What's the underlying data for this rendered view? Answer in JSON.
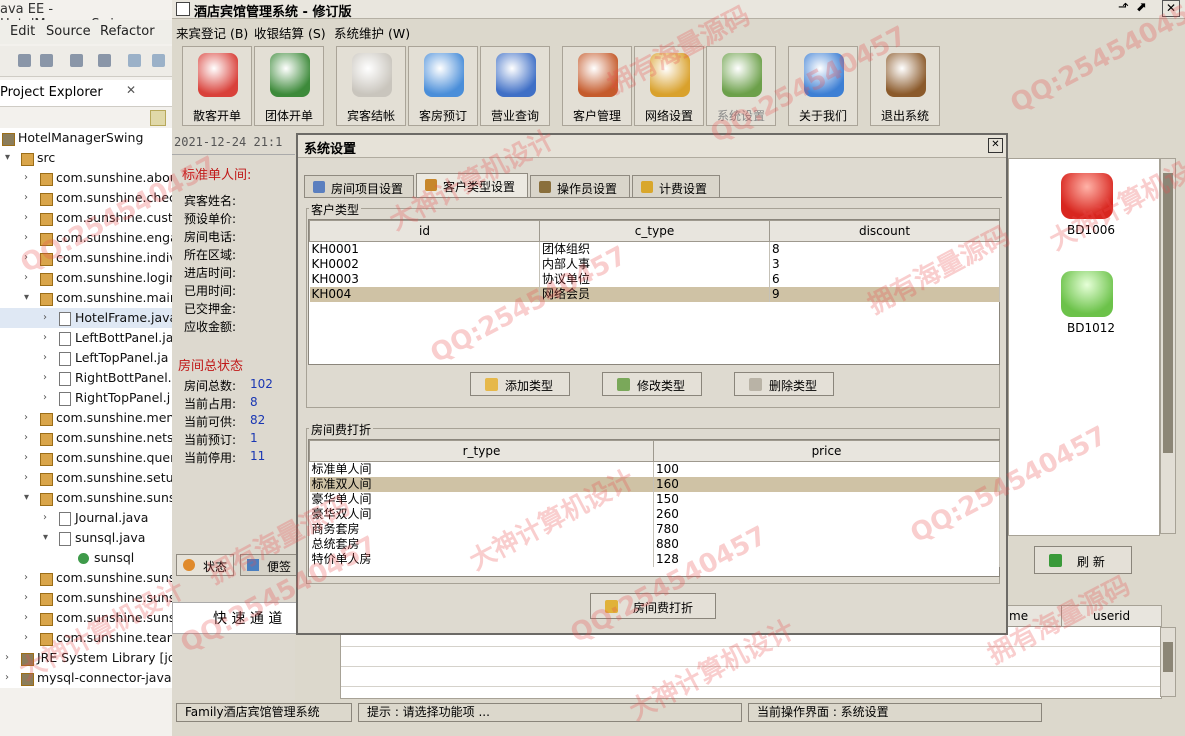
{
  "eclipse": {
    "title": "ava EE - HotelManagerSwing",
    "menus": [
      "Edit",
      "Source",
      "Refactor"
    ],
    "view_title": "Project Explorer",
    "tree": [
      {
        "label": "HotelManagerSwing",
        "depth": 0,
        "kind": "project",
        "expanded": true
      },
      {
        "label": "src",
        "depth": 1,
        "kind": "folder",
        "expanded": true
      },
      {
        "label": "com.sunshine.abou",
        "depth": 2,
        "kind": "package"
      },
      {
        "label": "com.sunshine.chec",
        "depth": 2,
        "kind": "package"
      },
      {
        "label": "com.sunshine.custo",
        "depth": 2,
        "kind": "package"
      },
      {
        "label": "com.sunshine.enga",
        "depth": 2,
        "kind": "package"
      },
      {
        "label": "com.sunshine.indiv",
        "depth": 2,
        "kind": "package"
      },
      {
        "label": "com.sunshine.login",
        "depth": 2,
        "kind": "package"
      },
      {
        "label": "com.sunshine.main",
        "depth": 2,
        "kind": "package",
        "expanded": true
      },
      {
        "label": "HotelFrame.java",
        "depth": 3,
        "kind": "file",
        "selected": true
      },
      {
        "label": "LeftBottPanel.ja",
        "depth": 3,
        "kind": "file"
      },
      {
        "label": "LeftTopPanel.ja",
        "depth": 3,
        "kind": "file"
      },
      {
        "label": "RightBottPanel.",
        "depth": 3,
        "kind": "file"
      },
      {
        "label": "RightTopPanel.j",
        "depth": 3,
        "kind": "file"
      },
      {
        "label": "com.sunshine.menu",
        "depth": 2,
        "kind": "package"
      },
      {
        "label": "com.sunshine.netse",
        "depth": 2,
        "kind": "package"
      },
      {
        "label": "com.sunshine.quer",
        "depth": 2,
        "kind": "package"
      },
      {
        "label": "com.sunshine.setup",
        "depth": 2,
        "kind": "package"
      },
      {
        "label": "com.sunshine.suns",
        "depth": 2,
        "kind": "package",
        "expanded": true
      },
      {
        "label": "Journal.java",
        "depth": 3,
        "kind": "file"
      },
      {
        "label": "sunsql.java",
        "depth": 3,
        "kind": "file",
        "expanded": true
      },
      {
        "label": "sunsql",
        "depth": 4,
        "kind": "class"
      },
      {
        "label": "com.sunshine.suns",
        "depth": 2,
        "kind": "package"
      },
      {
        "label": "com.sunshine.suns",
        "depth": 2,
        "kind": "package"
      },
      {
        "label": "com.sunshine.suns",
        "depth": 2,
        "kind": "package"
      },
      {
        "label": "com.sunshine.team",
        "depth": 2,
        "kind": "package"
      },
      {
        "label": "JRE System Library [jd",
        "depth": 1,
        "kind": "library"
      },
      {
        "label": "mysql-connector-java",
        "depth": 1,
        "kind": "library"
      }
    ]
  },
  "app": {
    "title": "酒店宾馆管理系统 - 修订版",
    "menus": [
      "来宾登记 (B)",
      "收银结算 (S)",
      "系统维护 (W)"
    ],
    "toolbar": [
      {
        "label": "散客开单",
        "icon": "person-icon",
        "color": "#d9413a"
      },
      {
        "label": "团体开单",
        "icon": "group-icon",
        "color": "#3d8a3a"
      },
      {
        "label": "宾客结帐",
        "icon": "monitor-icon",
        "color": "#c9c5bd"
      },
      {
        "label": "客房预订",
        "icon": "compass-icon",
        "color": "#4a8ed9"
      },
      {
        "label": "营业查询",
        "icon": "search-folder-icon",
        "color": "#3f6fc6"
      },
      {
        "label": "客户管理",
        "icon": "users-icon",
        "color": "#c55b2c"
      },
      {
        "label": "网络设置",
        "icon": "network-icon",
        "color": "#d9a12c"
      },
      {
        "label": "系统设置",
        "icon": "settings-icon",
        "color": "#6ca04a"
      },
      {
        "label": "关于我们",
        "icon": "about-icon",
        "color": "#3d7fd4"
      },
      {
        "label": "退出系统",
        "icon": "exit-icon",
        "color": "#8b5a2b"
      }
    ],
    "datetime": "2021-12-24  21:1",
    "room_panel": {
      "title": "标准单人间:",
      "fields": [
        "宾客姓名:",
        "预设单价:",
        "房间电话:",
        "所在区域:",
        "进店时间:",
        "已用时间:",
        "已交押金:",
        "应收金额:"
      ]
    },
    "status_panel": {
      "title": "房间总状态",
      "rows": [
        {
          "label": "房间总数:",
          "value": "102"
        },
        {
          "label": "当前占用:",
          "value": "8"
        },
        {
          "label": "当前可供:",
          "value": "82"
        },
        {
          "label": "当前预订:",
          "value": "1"
        },
        {
          "label": "当前停用:",
          "value": "11"
        }
      ]
    },
    "left_tabs": [
      "状态",
      "便签"
    ],
    "quick_channel": "快 速 通 道",
    "rooms": [
      {
        "label": "BD1006",
        "color": "#d8261f"
      },
      {
        "label": "BD1012",
        "color": "#6cc24a"
      }
    ],
    "refresh_label": "刷 新",
    "bottom_table_headers": [
      "me",
      "userid"
    ],
    "status_bar": {
      "left": "Family酒店宾馆管理系统",
      "hint": "提示 : 请选择功能项 ...",
      "current": "当前操作界面 : 系统设置"
    }
  },
  "dialog": {
    "title": "系统设置",
    "tabs": [
      {
        "label": "房间项目设置",
        "active": false
      },
      {
        "label": "客户类型设置",
        "active": true
      },
      {
        "label": "操作员设置",
        "active": false
      },
      {
        "label": "计费设置",
        "active": false
      }
    ],
    "customer_group": "客户类型",
    "customer_headers": [
      "id",
      "c_type",
      "discount"
    ],
    "customer_rows": [
      {
        "id": "KH0001",
        "c_type": "团体组织",
        "discount": "8",
        "selected": false
      },
      {
        "id": "KH0002",
        "c_type": "内部人事",
        "discount": "3",
        "selected": false
      },
      {
        "id": "KH0003",
        "c_type": "协议单位",
        "discount": "6",
        "selected": false
      },
      {
        "id": "KH004",
        "c_type": "网络会员",
        "discount": "9",
        "selected": true
      }
    ],
    "buttons": {
      "add": "添加类型",
      "edit": "修改类型",
      "delete": "删除类型"
    },
    "price_group": "房间费打折",
    "price_headers": [
      "r_type",
      "price"
    ],
    "price_rows": [
      {
        "r_type": "标准单人间",
        "price": "100",
        "selected": false
      },
      {
        "r_type": "标准双人间",
        "price": "160",
        "selected": true
      },
      {
        "r_type": "豪华单人间",
        "price": "150",
        "selected": false
      },
      {
        "r_type": "豪华双人间",
        "price": "260",
        "selected": false
      },
      {
        "r_type": "商务套房",
        "price": "780",
        "selected": false
      },
      {
        "r_type": "总统套房",
        "price": "880",
        "selected": false
      },
      {
        "r_type": "特价单人房",
        "price": "128",
        "selected": false
      }
    ],
    "discount_button": "房间费打折"
  },
  "watermarks": [
    "QQ:254540457",
    "拥有海量源码",
    "大神计算机设计"
  ]
}
